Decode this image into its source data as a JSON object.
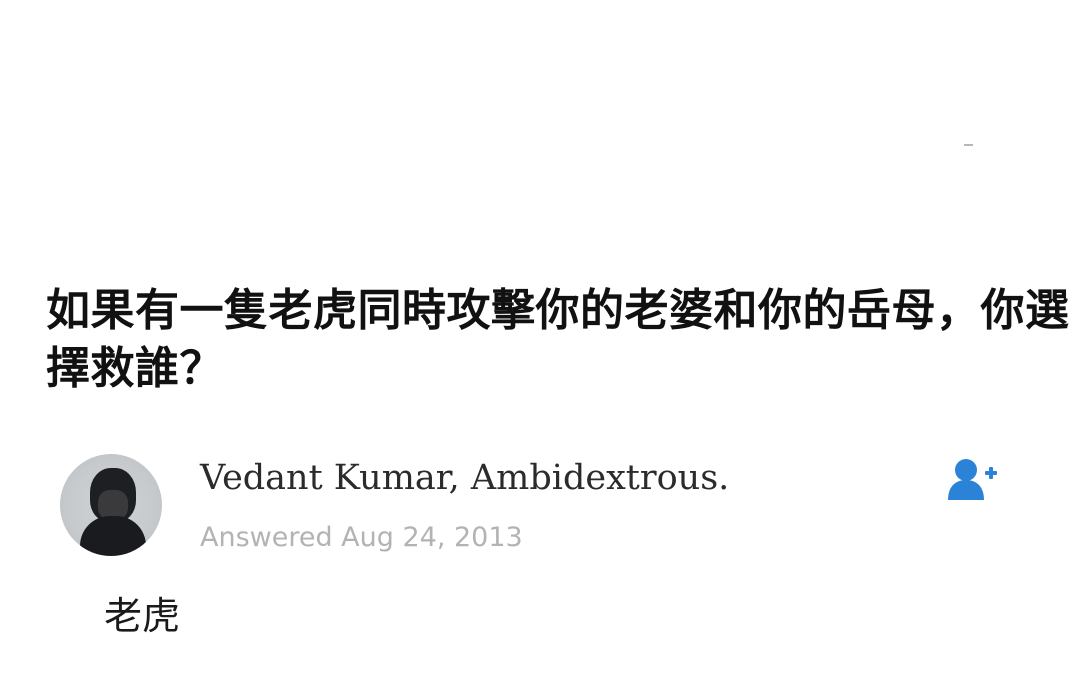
{
  "question": {
    "text": "如果有一隻老虎同時攻擊你的老婆和你的岳母，你選擇救誰？"
  },
  "answer": {
    "author": "Vedant Kumar, Ambidextrous.",
    "date": "Answered Aug 24, 2013",
    "body": "老虎",
    "follow_icon": "add-user-icon",
    "accent_color": "#2b83d8"
  }
}
